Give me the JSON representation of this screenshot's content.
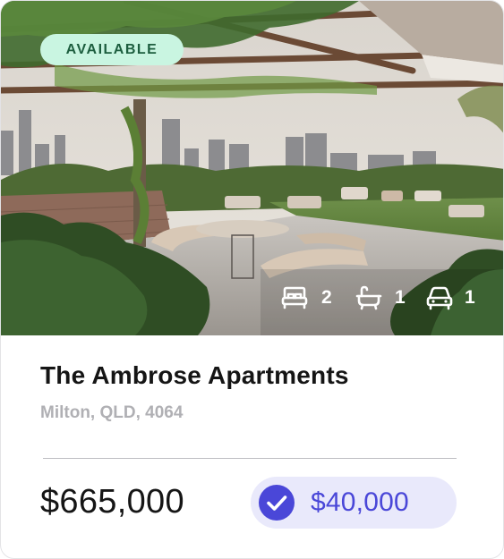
{
  "listing": {
    "status_badge": "AVAILABLE",
    "title": "The Ambrose Apartments",
    "address": "Milton, QLD, 4064",
    "price": "$665,000",
    "rebate_amount": "$40,000",
    "features": {
      "bedrooms": "2",
      "bathrooms": "1",
      "car_spaces": "1"
    },
    "icons": {
      "bedrooms": "bed-icon",
      "bathrooms": "bathtub-icon",
      "car_spaces": "car-icon",
      "rebate": "check-circle-icon"
    }
  },
  "colors": {
    "badge_background": "#c9f5e1",
    "badge_text": "#1d5e3f",
    "rebate_background": "#e9e9fb",
    "rebate_accent": "#4a47d8",
    "title_text": "#151515",
    "address_text": "#b0b0b4"
  }
}
